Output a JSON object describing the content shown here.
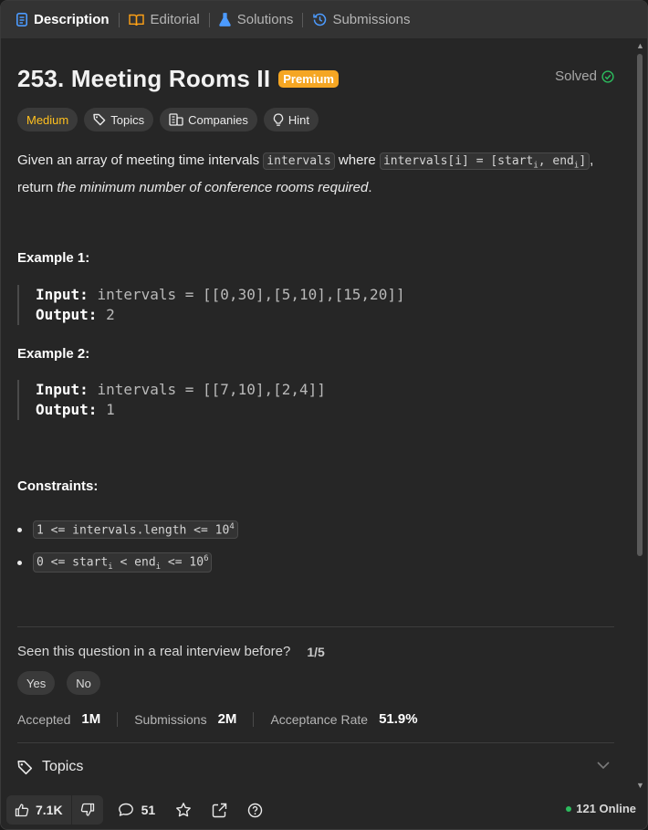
{
  "tabs": [
    {
      "label": "Description",
      "icon": "description-icon",
      "active": true
    },
    {
      "label": "Editorial",
      "icon": "book-icon"
    },
    {
      "label": "Solutions",
      "icon": "flask-icon"
    },
    {
      "label": "Submissions",
      "icon": "history-icon"
    }
  ],
  "problem": {
    "title": "253. Meeting Rooms II",
    "premium_label": "Premium",
    "status": "Solved",
    "difficulty": "Medium",
    "chips": {
      "topics": "Topics",
      "companies": "Companies",
      "hint": "Hint"
    }
  },
  "description": {
    "part1": "Given an array of meeting time intervals ",
    "code1": "intervals",
    "part2": " where ",
    "code2_a": "intervals[i] = [start",
    "code2_sub1": "i",
    "code2_b": ", end",
    "code2_sub2": "i",
    "code2_c": "]",
    "part3": ",",
    "part4": "return ",
    "emph": "the minimum number of conference rooms required",
    "part5": "."
  },
  "examples": [
    {
      "title": "Example 1:",
      "input_label": "Input:",
      "input": "intervals = [[0,30],[5,10],[15,20]]",
      "output_label": "Output:",
      "output": "2"
    },
    {
      "title": "Example 2:",
      "input_label": "Input:",
      "input": "intervals = [[7,10],[2,4]]",
      "output_label": "Output:",
      "output": "1"
    }
  ],
  "constraints": {
    "title": "Constraints:",
    "c1_a": "1 <= intervals.length <= 10",
    "c1_sup": "4",
    "c2_a": "0 <= start",
    "c2_sub1": "i",
    "c2_b": " < end",
    "c2_sub2": "i",
    "c2_c": " <= 10",
    "c2_sup": "6"
  },
  "interview": {
    "question": "Seen this question in a real interview before?",
    "count": "1/5",
    "yes": "Yes",
    "no": "No"
  },
  "stats": {
    "accepted_label": "Accepted",
    "accepted_value": "1M",
    "submissions_label": "Submissions",
    "submissions_value": "2M",
    "rate_label": "Acceptance Rate",
    "rate_value": "51.9%"
  },
  "topics_section": {
    "label": "Topics"
  },
  "bottom": {
    "likes": "7.1K",
    "comments": "51",
    "online": "121 Online"
  },
  "colors": {
    "accent_medium": "#ffc01e",
    "premium": "#f5a623",
    "solved": "#2cbb5d",
    "online_dot": "#2cbb5d"
  }
}
